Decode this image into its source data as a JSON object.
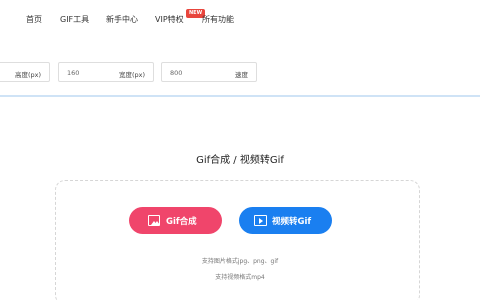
{
  "nav": {
    "items": [
      "首页",
      "GIF工具",
      "新手中心",
      "VIP特权",
      "所有功能"
    ],
    "badge": "NEW"
  },
  "params": {
    "height": {
      "value": "",
      "label": "高度(px)"
    },
    "width": {
      "value": "160",
      "label": "宽度(px)"
    },
    "speed": {
      "value": "800",
      "label": "速度"
    }
  },
  "main": {
    "heading": "Gif合成 / 视频转Gif",
    "gif_button": "Gif合成",
    "video_button": "视频转Gif",
    "image_formats_hint": "支持图片格式jpg、png、gif",
    "video_formats_hint": "支持视频格式mp4"
  },
  "colors": {
    "pink_button": "#f0456b",
    "blue_button": "#1a7ff0",
    "badge": "#e8453c"
  },
  "icons": {
    "gif_button": "image-icon",
    "video_button": "video-icon"
  }
}
